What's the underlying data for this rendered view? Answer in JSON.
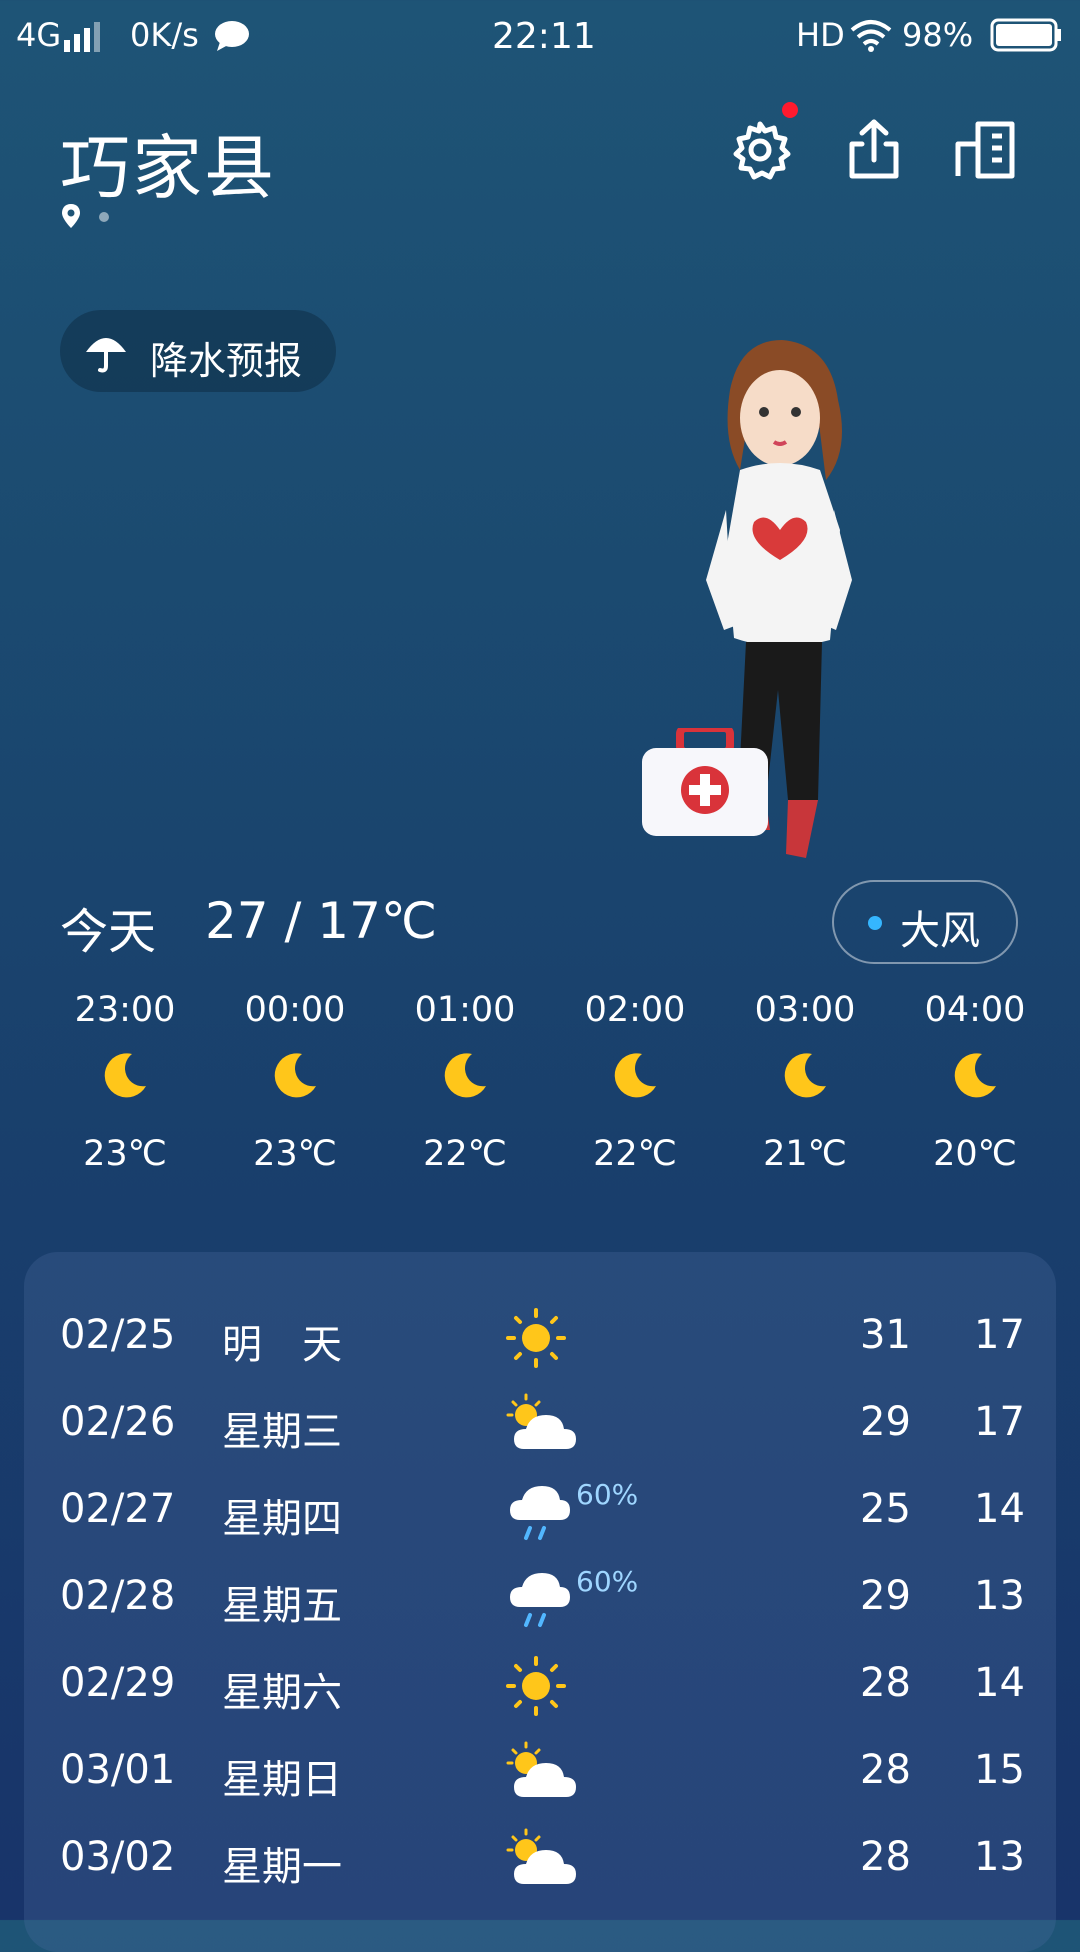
{
  "status_bar": {
    "network": "4G",
    "speed": "0K/s",
    "time": "22:11",
    "hd": "HD",
    "battery": "98%"
  },
  "header": {
    "city": "巧家县",
    "icons": [
      "gear-icon",
      "share-icon",
      "city-list-icon"
    ],
    "settings_has_badge": true
  },
  "precip_button": {
    "icon": "umbrella-icon",
    "label": "降水预报"
  },
  "today": {
    "label": "今天",
    "range": "27 / 17℃"
  },
  "wind_badge": {
    "label": "大风",
    "dot_color": "#35b6ff"
  },
  "hourly": [
    {
      "time": "23:00",
      "icon": "moon-icon",
      "temp": "23℃"
    },
    {
      "time": "00:00",
      "icon": "moon-icon",
      "temp": "23℃"
    },
    {
      "time": "01:00",
      "icon": "moon-icon",
      "temp": "22℃"
    },
    {
      "time": "02:00",
      "icon": "moon-icon",
      "temp": "22℃"
    },
    {
      "time": "03:00",
      "icon": "moon-icon",
      "temp": "21℃"
    },
    {
      "time": "04:00",
      "icon": "moon-icon",
      "temp": "20℃"
    }
  ],
  "daily": [
    {
      "date": "02/25",
      "day": "明　天",
      "icon": "sun-icon",
      "pop": "",
      "high": "31",
      "low": "17"
    },
    {
      "date": "02/26",
      "day": "星期三",
      "icon": "partly-cloudy-icon",
      "pop": "",
      "high": "29",
      "low": "17"
    },
    {
      "date": "02/27",
      "day": "星期四",
      "icon": "rain-icon",
      "pop": "60%",
      "high": "25",
      "low": "14"
    },
    {
      "date": "02/28",
      "day": "星期五",
      "icon": "rain-icon",
      "pop": "60%",
      "high": "29",
      "low": "13"
    },
    {
      "date": "02/29",
      "day": "星期六",
      "icon": "sun-icon",
      "pop": "",
      "high": "28",
      "low": "14"
    },
    {
      "date": "03/01",
      "day": "星期日",
      "icon": "partly-cloudy-icon",
      "pop": "",
      "high": "28",
      "low": "15"
    },
    {
      "date": "03/02",
      "day": "星期一",
      "icon": "partly-cloudy-icon",
      "pop": "",
      "high": "28",
      "low": "13"
    }
  ],
  "colors": {
    "sun": "#ffc61a",
    "moon": "#ffc61a",
    "rain": "#52b7ff",
    "badge": "#ff1a2e"
  }
}
